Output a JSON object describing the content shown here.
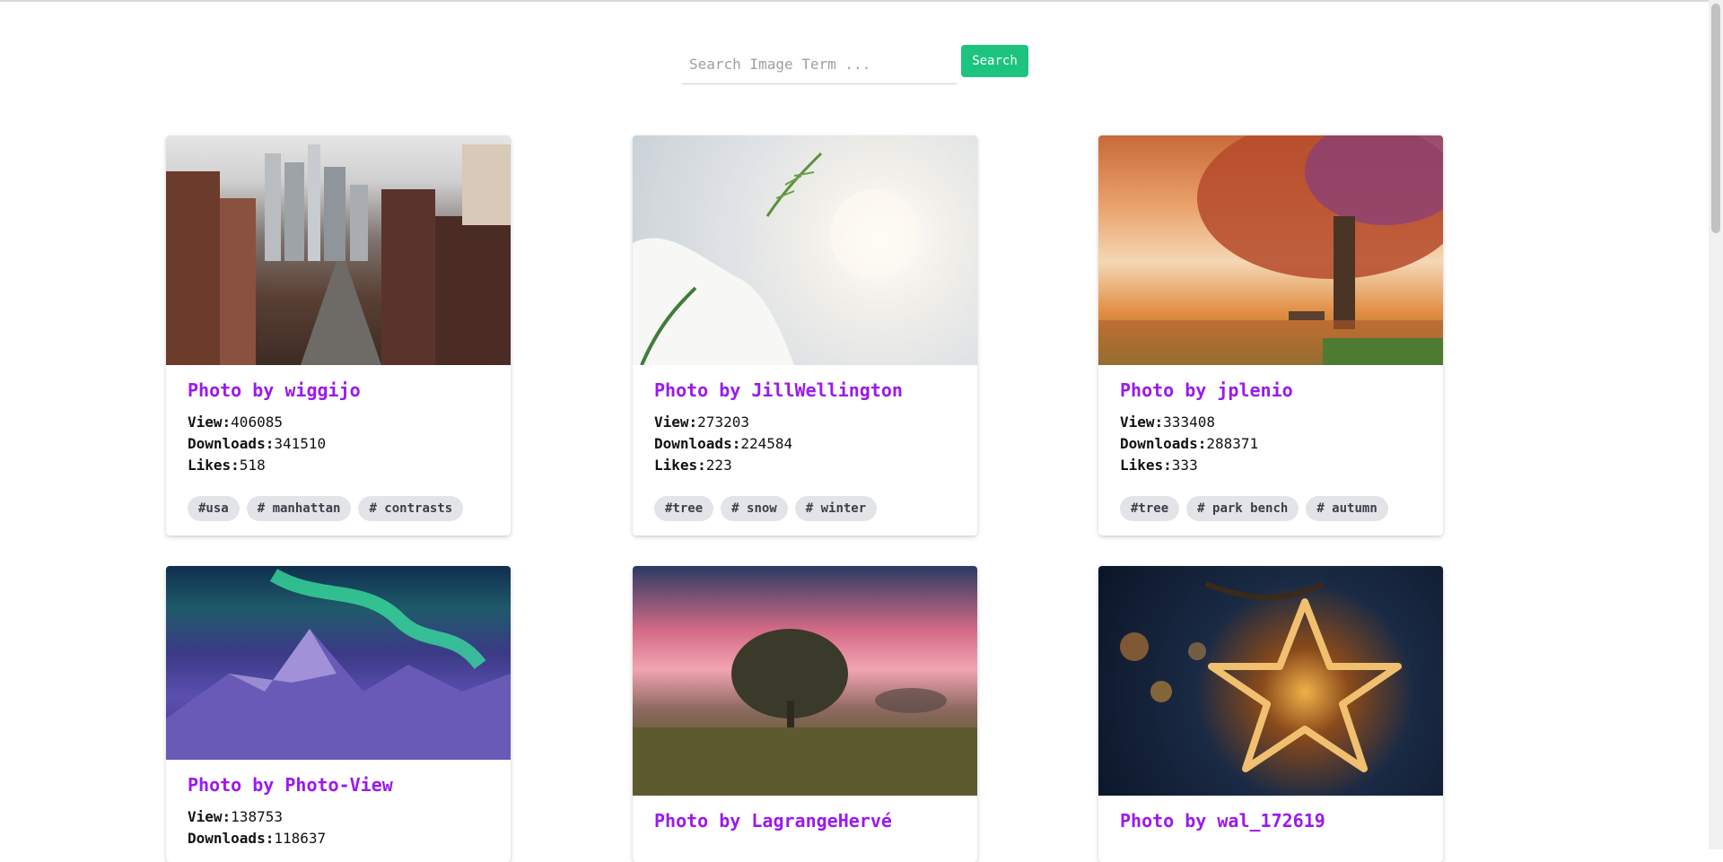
{
  "search": {
    "placeholder": "Search Image Term ...",
    "button_label": "Search",
    "accent_color": "#1dc47f"
  },
  "cards": [
    {
      "title": "Photo by wiggijo",
      "view_label": "View:",
      "views": "406085",
      "downloads_label": "Downloads:",
      "downloads": "341510",
      "likes_label": "Likes:",
      "likes": "518",
      "tags": [
        "#usa",
        "# manhattan",
        "# contrasts"
      ]
    },
    {
      "title": "Photo by JillWellington",
      "view_label": "View:",
      "views": "273203",
      "downloads_label": "Downloads:",
      "downloads": "224584",
      "likes_label": "Likes:",
      "likes": "223",
      "tags": [
        "#tree",
        "# snow",
        "# winter"
      ]
    },
    {
      "title": "Photo by jplenio",
      "view_label": "View:",
      "views": "333408",
      "downloads_label": "Downloads:",
      "downloads": "288371",
      "likes_label": "Likes:",
      "likes": "333",
      "tags": [
        "#tree",
        "# park bench",
        "# autumn"
      ]
    },
    {
      "title": "Photo by Photo-View",
      "view_label": "View:",
      "views": "138753",
      "downloads_label": "Downloads:",
      "downloads": "118637"
    },
    {
      "title": "Photo by LagrangeHervé"
    },
    {
      "title": "Photo by wal_172619"
    }
  ],
  "title_color": "#9b19ef"
}
